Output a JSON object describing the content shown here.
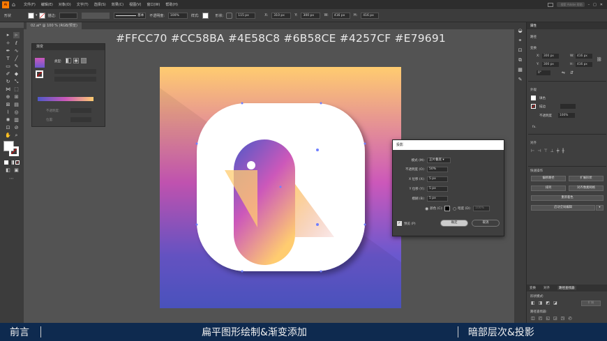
{
  "menubar": {
    "app_logo": "Ai",
    "items": [
      "文件(F)",
      "编辑(E)",
      "对象(O)",
      "文字(T)",
      "选择(S)",
      "效果(C)",
      "视图(V)",
      "窗口(W)",
      "帮助(H)"
    ],
    "search_placeholder": "搜索 Adobe 帮助"
  },
  "optionbar": {
    "selection_label": "形状",
    "stroke_label": "描边:",
    "stroke_style": "基本",
    "opacity_label": "不透明度:",
    "opacity_value": "100%",
    "style_label": "样式:",
    "shape_label": "形状:",
    "w_value": "115 px",
    "x_label": "X:",
    "x_value": "310 px",
    "y_label": "Y:",
    "y_value": "300 px",
    "w_label": "W:",
    "w2_value": "416 px",
    "h_label": "H:",
    "h_value": "416 px"
  },
  "document": {
    "tab_title": "02.ai* @ 100 % (RGB/预览)"
  },
  "color_codes": "#FFCC70  #CC58BA  #4E58C8  #6B58CE  #4257CF  #E79691",
  "gradient_panel": {
    "title": "渐变",
    "type_label": "类型:",
    "opacity_label": "不透明度:",
    "location_label": "位置:"
  },
  "dialog": {
    "title": "投影",
    "mode_label": "模式 (M):",
    "mode_value": "正片叠底",
    "opacity_label": "不透明度 (O):",
    "opacity_value": "50%",
    "x_offset_label": "X 位移 (X):",
    "x_offset_value": "5 px",
    "y_offset_label": "Y 位移 (Y):",
    "y_offset_value": "5 px",
    "blur_label": "模糊 (B):",
    "blur_value": "5 px",
    "color_label": "颜色 (C):",
    "darkness_label": "暗度 (D):",
    "darkness_value": "100%",
    "preview_label": "预览 (P)",
    "ok_label": "确定",
    "cancel_label": "取消"
  },
  "properties_panel": {
    "tab": "属性",
    "path_label": "路径",
    "transform_label": "变换",
    "x_label": "X:",
    "x_value": "300 px",
    "y_label": "Y:",
    "y_value": "300 px",
    "w_label": "W:",
    "w_value": "416 px",
    "h_label": "H:",
    "h_value": "416 px",
    "angle_value": "0°",
    "appearance_label": "外观",
    "fill_label": "填色",
    "stroke_label": "描边",
    "opacity_label": "不透明度",
    "opacity_value": "100%",
    "fx_label": "fx.",
    "align_label": "对齐",
    "quick_actions_label": "快速操作",
    "actions": [
      "偏移路径",
      "扩展形状",
      "排列",
      "对齐像素网格",
      "重新着色",
      "启动全局编辑"
    ],
    "bottom_tabs": [
      "变换",
      "对齐",
      "路径查找器"
    ],
    "shape_modes_label": "形状模式:",
    "pathfinder_label": "路径查找器:",
    "expand_label": "扩展"
  },
  "bottom_bar": {
    "left": "前言",
    "center": "扁平图形绘制&渐变添加",
    "right": "暗部层次&投影"
  },
  "colors": {
    "gradient": [
      "#FFCC70",
      "#E79691",
      "#CC58BA",
      "#6B58CE",
      "#4E58C8"
    ],
    "bottom_bar_bg": "#0e2a4f"
  }
}
